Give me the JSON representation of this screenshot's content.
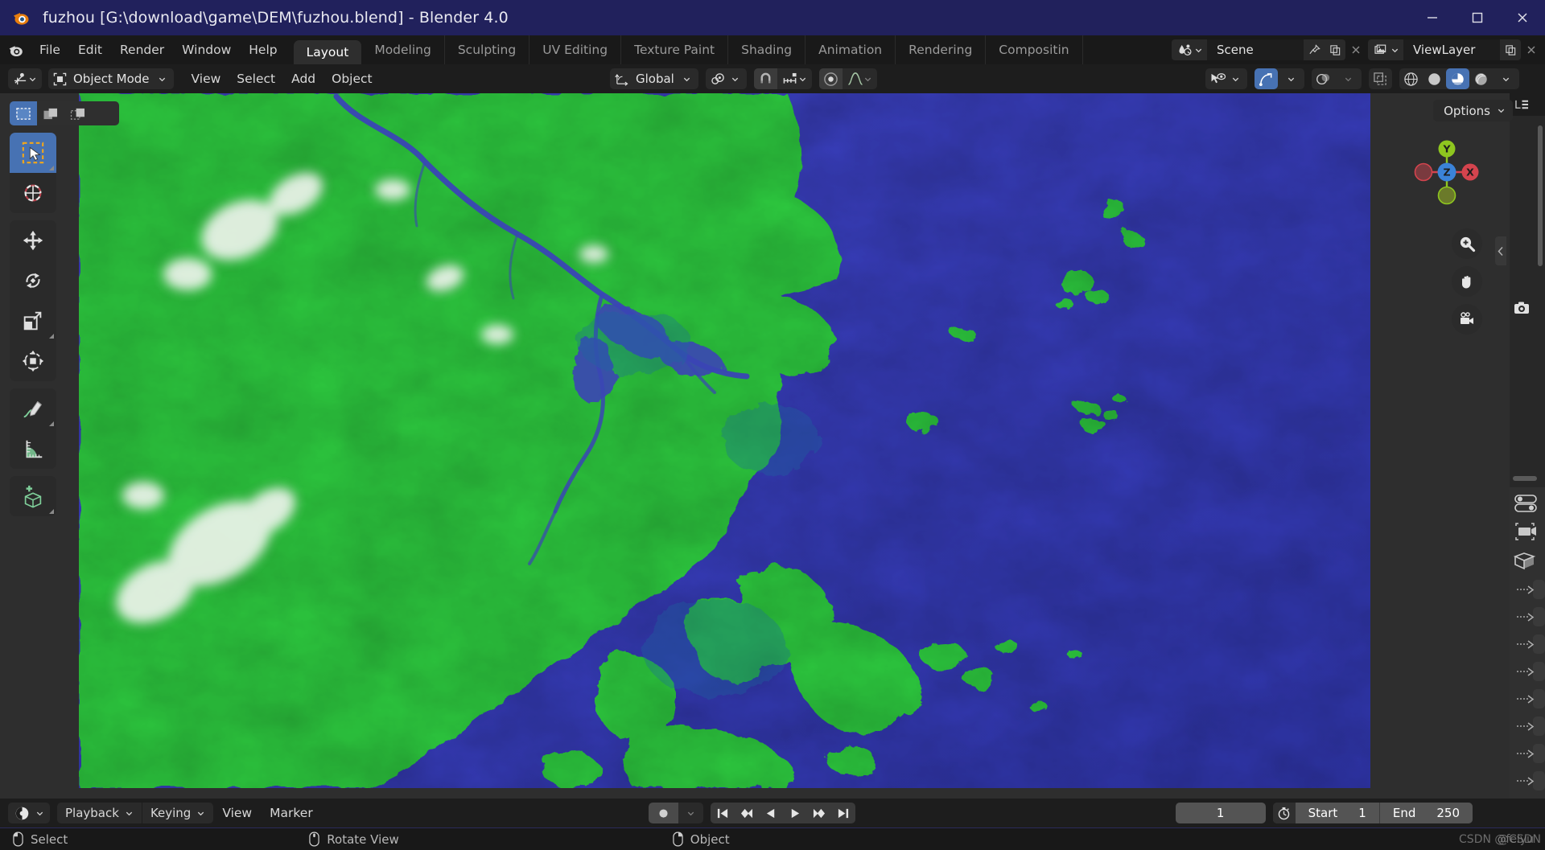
{
  "window": {
    "title": "fuzhou [G:\\download\\game\\DEM\\fuzhou.blend] - Blender 4.0",
    "app_icon": "blender-logo-icon",
    "controls": {
      "minimize": "minimize-icon",
      "maximize": "maximize-icon",
      "close": "close-icon"
    },
    "titlebar_color": "#21215c"
  },
  "topbar": {
    "menus": [
      "File",
      "Edit",
      "Render",
      "Window",
      "Help"
    ],
    "workspaces": [
      {
        "label": "Layout",
        "active": true
      },
      {
        "label": "Modeling",
        "active": false
      },
      {
        "label": "Sculpting",
        "active": false
      },
      {
        "label": "UV Editing",
        "active": false
      },
      {
        "label": "Texture Paint",
        "active": false
      },
      {
        "label": "Shading",
        "active": false
      },
      {
        "label": "Animation",
        "active": false
      },
      {
        "label": "Rendering",
        "active": false
      },
      {
        "label": "Compositin",
        "active": false
      }
    ],
    "scene": {
      "icon": "scene-icon",
      "name": "Scene",
      "pin": "pin-icon",
      "new": "copy-icon",
      "unlink": "x-icon"
    },
    "viewlayer": {
      "icon": "viewlayer-icon",
      "name": "ViewLayer",
      "new": "copy-icon",
      "remove": "x-icon"
    }
  },
  "viewport_header": {
    "editor_type": "editor-type-icon",
    "mode": {
      "icon": "object-mode-icon",
      "label": "Object Mode"
    },
    "menus": [
      "View",
      "Select",
      "Add",
      "Object"
    ],
    "transform_orientation": {
      "icon": "orientation-icon",
      "label": "Global"
    },
    "pivot": {
      "icon": "pivot-icon"
    },
    "snapping": {
      "magnet_icon": "magnet-icon",
      "snap_to_icon": "snap-increment-icon",
      "enabled": false
    },
    "proportional": {
      "icon": "proportional-edit-icon",
      "falloff_icon": "falloff-curve-icon",
      "enabled": false
    },
    "visibility": {
      "icon": "visibility-eye-icon"
    },
    "gizmo": {
      "icon": "gizmo-icon",
      "enabled": true
    },
    "overlays": {
      "icon": "overlays-icon",
      "enabled": false
    },
    "xray": {
      "icon": "xray-icon",
      "enabled": false
    },
    "shading_modes": [
      {
        "name": "wireframe",
        "icon": "wireframe-icon",
        "active": false
      },
      {
        "name": "solid",
        "icon": "solid-sphere-icon",
        "active": false
      },
      {
        "name": "material-preview",
        "icon": "material-preview-icon",
        "active": true
      },
      {
        "name": "rendered",
        "icon": "rendered-icon",
        "active": false
      }
    ],
    "options_label": "Options"
  },
  "toolbar": {
    "select_modes": [
      {
        "name": "tweak",
        "icon": "select-box-icon",
        "active": true
      },
      {
        "name": "extend",
        "icon": "select-extend-icon",
        "active": false
      },
      {
        "name": "subtract",
        "icon": "select-subtract-icon",
        "active": false
      }
    ],
    "tools": [
      {
        "name": "select-box-tool",
        "icon": "cursor-box-icon",
        "active": true,
        "has_submenu": true
      },
      {
        "name": "cursor-tool",
        "icon": "3d-cursor-icon",
        "active": false,
        "has_submenu": false
      },
      {
        "name": "move-tool",
        "icon": "move-arrows-icon",
        "active": false,
        "has_submenu": false
      },
      {
        "name": "rotate-tool",
        "icon": "rotate-icon",
        "active": false,
        "has_submenu": false
      },
      {
        "name": "scale-tool",
        "icon": "scale-icon",
        "active": false,
        "has_submenu": true
      },
      {
        "name": "transform-tool",
        "icon": "transform-icon",
        "active": false,
        "has_submenu": false
      },
      {
        "name": "annotate-tool",
        "icon": "pencil-icon",
        "active": false,
        "has_submenu": true
      },
      {
        "name": "measure-tool",
        "icon": "ruler-icon",
        "active": false,
        "has_submenu": false
      },
      {
        "name": "add-cube-tool",
        "icon": "add-cube-icon",
        "active": false,
        "has_submenu": true
      }
    ]
  },
  "nav": {
    "gizmo": {
      "axes": [
        {
          "label": "Z",
          "color": "#3b83d8",
          "role": "center"
        },
        {
          "label": "Y",
          "color": "#8ec61f",
          "role": "positive-y"
        },
        {
          "label": "X",
          "color": "#d4444e",
          "role": "positive-x"
        },
        {
          "label": "",
          "color": "#6b7a2a",
          "role": "negative-y"
        },
        {
          "label": "",
          "color": "#7a3a3f",
          "role": "negative-x"
        }
      ]
    },
    "buttons": [
      {
        "name": "zoom-view-button",
        "icon": "magnifier-plus-icon"
      },
      {
        "name": "pan-view-button",
        "icon": "hand-icon"
      },
      {
        "name": "camera-view-button",
        "icon": "camera-movie-icon"
      }
    ]
  },
  "right_panel": {
    "outliner_icon": "outliner-icon",
    "camera_item_icon": "camera-icon",
    "properties_tabs": [
      "tool-icon",
      "render-icon",
      "output-icon",
      "viewlayer-props-icon",
      "scene-props-icon",
      "world-icon",
      "object-props-icon",
      "modifier-icon",
      "particles-icon",
      "physics-icon",
      "constraints-icon",
      "data-icon",
      "material-icon"
    ]
  },
  "timeline": {
    "editor_icon": "timeline-editor-icon",
    "menus": [
      {
        "label": "Playback",
        "has_chevron": true
      },
      {
        "label": "Keying",
        "has_chevron": true
      },
      {
        "label": "View",
        "has_chevron": false
      },
      {
        "label": "Marker",
        "has_chevron": false
      }
    ],
    "record_icon": "record-dot-icon",
    "playback_buttons": [
      {
        "name": "jump-to-start-button",
        "icon": "skip-start-icon"
      },
      {
        "name": "previous-keyframe-button",
        "icon": "prev-keyframe-icon"
      },
      {
        "name": "play-reverse-button",
        "icon": "play-reverse-icon"
      },
      {
        "name": "play-button",
        "icon": "play-icon"
      },
      {
        "name": "next-keyframe-button",
        "icon": "next-keyframe-icon"
      },
      {
        "name": "jump-to-end-button",
        "icon": "skip-end-icon"
      }
    ],
    "current_frame": "1",
    "timer_icon": "stopwatch-icon",
    "start_label": "Start",
    "start_value": "1",
    "end_label": "End",
    "end_value": "250"
  },
  "statusbar": {
    "items": [
      {
        "icon": "mouse-left-icon",
        "label": "Select"
      },
      {
        "icon": "mouse-middle-icon",
        "label": "Rotate View"
      },
      {
        "icon": "mouse-right-icon",
        "label": "Object"
      }
    ],
    "watermark": "CSDN @feiyu",
    "watermark_overlay": "@CSDN"
  },
  "scene_render": {
    "description": "DEM terrain map of Fuzhou region: green land elevation mesh with white snow-capped highlands, blue ocean and river network",
    "land_color": "#2ecc40",
    "ocean_color": "#3b40c0",
    "river_color": "#3a45b5",
    "highland_color": "#e8efe4"
  }
}
